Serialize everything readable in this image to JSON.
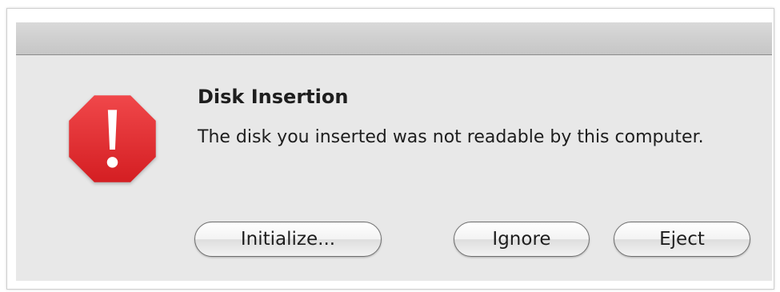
{
  "dialog": {
    "title": "Disk Insertion",
    "message": "The disk you inserted was not readable by this computer.",
    "icon": "alert-stop-icon",
    "icon_color": "#e3282b"
  },
  "buttons": {
    "initialize_label": "Initialize...",
    "ignore_label": "Ignore",
    "eject_label": "Eject"
  }
}
